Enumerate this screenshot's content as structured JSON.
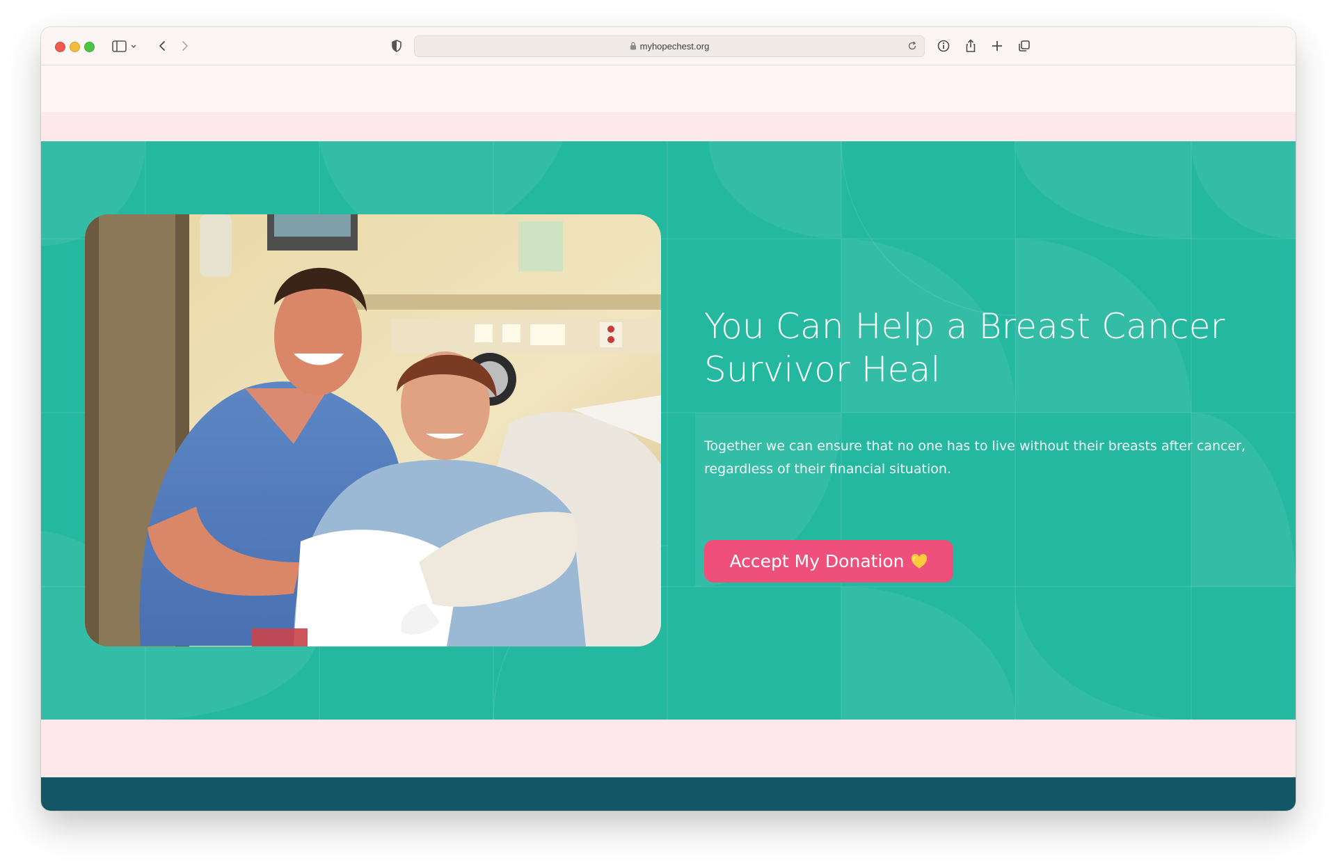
{
  "browser": {
    "url": "myhopechest.org",
    "icons": {
      "sidebar": "sidebar-icon",
      "back": "chevron-left-icon",
      "forward": "chevron-right-icon",
      "privacy": "shield-icon",
      "reload": "reload-icon",
      "info": "info-icon",
      "share": "share-icon",
      "new_tab": "plus-icon",
      "tabs": "tabs-icon"
    }
  },
  "hero": {
    "headline": "You Can Help a Breast Cancer Survivor Heal",
    "description": "Together we can ensure that no one has to live without their breasts after cancer, regardless of their financial situation.",
    "cta_label": "Accept My Donation",
    "cta_icon": "yellow-heart-icon"
  },
  "colors": {
    "hero_background": "#25b8a0",
    "cta_background": "#ee4f7b",
    "pink_band": "#fde8ec",
    "footer": "#135665"
  }
}
